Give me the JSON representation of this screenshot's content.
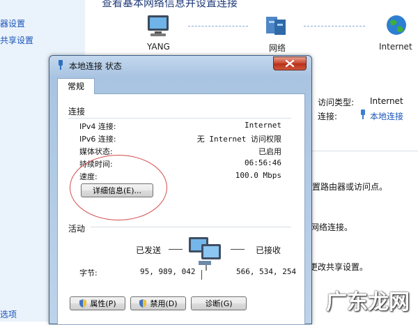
{
  "background": {
    "nav_links": [
      "器设置",
      "共享设置"
    ],
    "nav_bottom": "选项",
    "heading": "查看基本网络信息并设置连接",
    "map": {
      "computer": "YANG",
      "network": "网络",
      "internet": "Internet"
    },
    "access_type_label": "访问类型:",
    "access_type_value": "Internet",
    "connection_label": "连接:",
    "connection_value": "本地连接",
    "hints": [
      "设置路由器或访问点。",
      "网络连接。",
      "或更改共享设置。"
    ]
  },
  "dialog": {
    "title": "本地连接 状态",
    "tab": "常规",
    "connection": {
      "title": "连接",
      "rows": [
        {
          "label": "IPv4 连接:",
          "value": "Internet"
        },
        {
          "label": "IPv6 连接:",
          "value": "无 Internet 访问权限"
        },
        {
          "label": "媒体状态:",
          "value": "已启用"
        },
        {
          "label": "持续时间:",
          "value": "06:56:46"
        },
        {
          "label": "速度:",
          "value": "100.0 Mbps"
        }
      ],
      "details_button": "详细信息(E)..."
    },
    "activity": {
      "title": "活动",
      "sent": "已发送",
      "received": "已接收",
      "bytes_label": "字节:",
      "bytes_sent": "95, 989, 042",
      "bytes_received": "566, 534, 254"
    },
    "buttons": {
      "properties": "属性(P)",
      "disable": "禁用(D)",
      "diagnose": "诊断(G)"
    }
  },
  "watermark": "广东龙网",
  "colors": {
    "link": "#1a55b8",
    "annotation": "#d44a4a",
    "close": "#c9462d"
  }
}
